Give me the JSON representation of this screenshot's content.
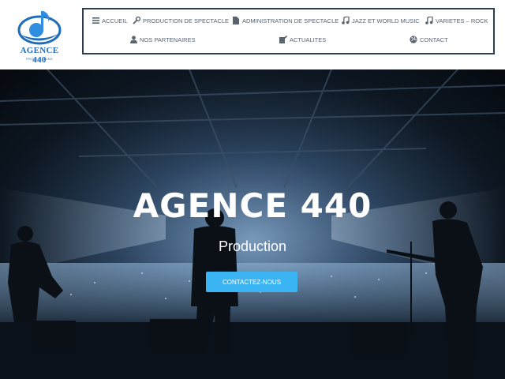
{
  "brand": {
    "name": "AGENCE 440",
    "tagline": "PRODUCTIONS",
    "logo_color": "#1f6db8"
  },
  "nav": {
    "items": [
      {
        "label": "ACCUEIL",
        "icon": "menu-icon"
      },
      {
        "label": "PRODUCTION DE SPECTACLE",
        "icon": "wrench-icon"
      },
      {
        "label": "ADMINISTRATION DE SPECTACLE",
        "icon": "document-icon"
      },
      {
        "label": "JAZZ ET WORLD MUSIC",
        "icon": "music-icon"
      },
      {
        "label": "VARIETES – ROCK",
        "icon": "music-icon"
      },
      {
        "label": "NOS PARTENAIRES",
        "icon": "user-icon"
      },
      {
        "label": "ACTUALITES",
        "icon": "edit-icon"
      },
      {
        "label": "CONTACT",
        "icon": "globe-icon"
      }
    ],
    "border_color": "#2c3e50"
  },
  "hero": {
    "title": "AGENCE 440",
    "subtitle": "Production",
    "cta_label": "CONTACTEZ-NOUS",
    "cta_color": "#3ab4f2"
  }
}
